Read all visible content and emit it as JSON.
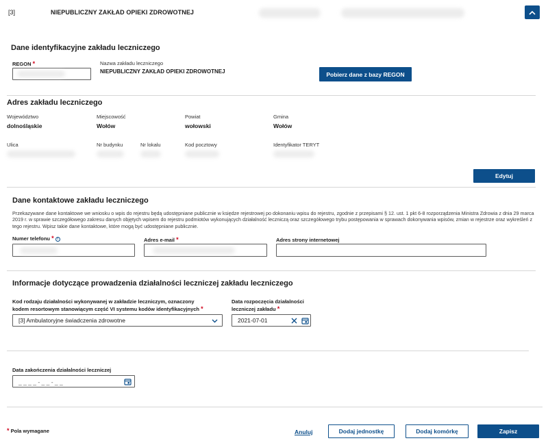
{
  "header": {
    "index": "[3]",
    "title": "NIEPUBLICZNY ZAKŁAD OPIEKI ZDROWOTNEJ"
  },
  "identification": {
    "title": "Dane identyfikacyjne zakładu leczniczego",
    "regon_label": "REGON",
    "regon_value": "",
    "name_label": "Nazwa zakładu leczniczego",
    "name_value": "NIEPUBLICZNY ZAKŁAD OPIEKI ZDROWOTNEJ",
    "fetch_button": "Pobierz dane z bazy REGON"
  },
  "address": {
    "title": "Adres zakładu leczniczego",
    "voivodeship_label": "Województwo",
    "voivodeship_value": "dolnośląskie",
    "city_label": "Miejscowość",
    "city_value": "Wołów",
    "county_label": "Powiat",
    "county_value": "wołowski",
    "commune_label": "Gmina",
    "commune_value": "Wołów",
    "street_label": "Ulica",
    "building_label": "Nr budynku",
    "unit_label": "Nr lokalu",
    "postal_label": "Kod pocztowy",
    "teryt_label": "Identyfikator TERYT",
    "edit_button": "Edytuj"
  },
  "contact": {
    "title": "Dane kontaktowe zakładu leczniczego",
    "description": "Przekazywane dane kontaktowe we wniosku o wpis do rejestru będą udostępniane publicznie w księdze rejestrowej po dokonaniu wpisu do rejestru, zgodnie z przepisami § 12. ust. 1 pkt 6-8 rozporządzenia Ministra Zdrowia z dnia 29 marca 2019 r. w sprawie szczegółowego zakresu danych objętych wpisem do rejestru podmiotów wykonujących działalność leczniczą oraz szczegółowego trybu postępowania w sprawach dokonywania wpisów, zmian w rejestrze oraz wykreśleń z tego rejestru. Wpisz takie dane kontaktowe, które mogą być udostępniane publicznie.",
    "phone_label": "Numer telefonu",
    "email_label": "Adres e-mail",
    "website_label": "Adres strony internetowej",
    "website_value": ""
  },
  "activity": {
    "title": "Informacje dotyczące prowadzenia działalności leczniczej zakładu leczniczego",
    "code_label": "Kod rodzaju działalności wykonywanej w zakładzie leczniczym, oznaczony kodem resortowym stanowiącym część VI systemu kodów identyfikacyjnych",
    "code_value": "[3] Ambulatoryjne świadczenia zdrowotne",
    "start_label": "Data rozpoczęcia działalności leczniczej zakładu",
    "start_value": "2021-07-01",
    "end_label": "Data zakończenia działalności leczniczej",
    "end_placeholder": "_ _ _ _ - _ _ - _ _"
  },
  "footer": {
    "required_note": "Pola wymagane",
    "required_mark": "*",
    "cancel": "Anuluj",
    "add_unit": "Dodaj jednostkę",
    "add_cell": "Dodaj komórkę",
    "save": "Zapisz"
  },
  "colors": {
    "primary": "#0d4f8b",
    "required": "#d0021b"
  }
}
